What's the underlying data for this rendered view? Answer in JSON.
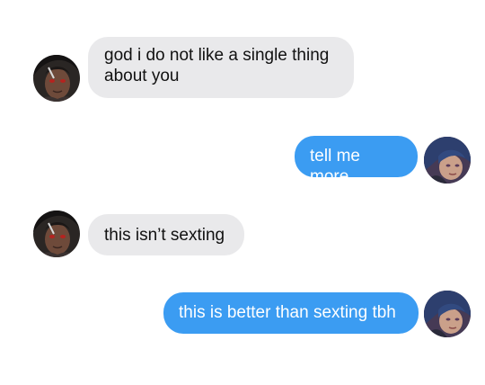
{
  "messages": [
    {
      "sender": "other",
      "text": "god i do not like a single thing\nabout you",
      "avatar": "avatar-dark-hair-red-eyes"
    },
    {
      "sender": "me",
      "text": "tell me more",
      "avatar": "avatar-blue-haired-girl"
    },
    {
      "sender": "other",
      "text": "this isn’t sexting",
      "avatar": "avatar-dark-hair-red-eyes"
    },
    {
      "sender": "me",
      "text": "this is better than sexting tbh",
      "avatar": "avatar-blue-haired-girl"
    }
  ],
  "colors": {
    "incoming_bubble": "#e9e9eb",
    "outgoing_bubble": "#3b9cf2",
    "incoming_text": "#111111",
    "outgoing_text": "#ffffff",
    "background": "#ffffff"
  }
}
